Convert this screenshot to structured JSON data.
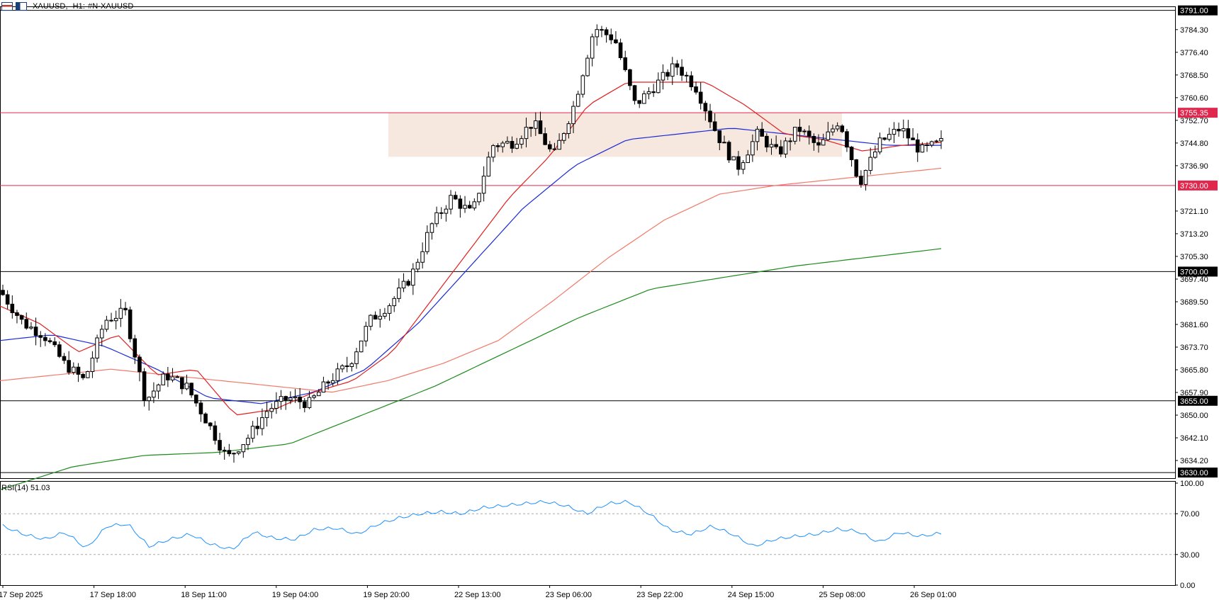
{
  "header": {
    "symbol": "XAUUSD",
    "timeframe": "H1:",
    "description": "#N-XAUUSD"
  },
  "price_axis": {
    "ticks": [
      "3784.30",
      "3776.40",
      "3768.50",
      "3760.60",
      "3752.70",
      "3744.80",
      "3736.90",
      "3721.10",
      "3713.20",
      "3705.30",
      "3697.40",
      "3689.50",
      "3681.60",
      "3673.70",
      "3665.80",
      "3657.90",
      "3650.00",
      "3642.10",
      "3634.20"
    ],
    "ylim": [
      3627.8,
      3792.4
    ]
  },
  "levels": [
    {
      "label": "3791.00",
      "value": 3791.0,
      "color": "#000000"
    },
    {
      "label": "3755.35",
      "value": 3755.35,
      "color": "#e0284f"
    },
    {
      "label": "3730.00",
      "value": 3730.0,
      "color": "#e0284f"
    },
    {
      "label": "3700.00",
      "value": 3700.0,
      "color": "#000000"
    },
    {
      "label": "3655.00",
      "value": 3655.0,
      "color": "#000000"
    },
    {
      "label": "3630.00",
      "value": 3630.0,
      "color": "#000000"
    }
  ],
  "zone": {
    "from_value": 3740.0,
    "to_value": 3755.35,
    "color": "#f7e8df"
  },
  "time_axis": [
    "17 Sep 2025",
    "17 Sep 18:00",
    "18 Sep 11:00",
    "19 Sep 04:00",
    "19 Sep 20:00",
    "22 Sep 13:00",
    "23 Sep 06:00",
    "23 Sep 22:00",
    "24 Sep 15:00",
    "25 Sep 08:00",
    "26 Sep 01:00"
  ],
  "rsi": {
    "label": "RSI(14) 51.03",
    "ticks": [
      "100.00",
      "70.00",
      "30.00",
      "0.00"
    ],
    "levels": [
      70,
      30
    ],
    "color": "#1e90ff"
  },
  "colors": {
    "ma_fast": "#e02020",
    "ma_mid": "#1a2bd6",
    "ma_slow": "#f07a6a",
    "ma_long": "#1c8a1c",
    "up_candle": "#ffffff",
    "down_candle": "#000000"
  },
  "chart_data": {
    "type": "candlestick",
    "interval": "H1",
    "x": [
      "17 Sep 2025",
      "17 Sep 18:00",
      "18 Sep 11:00",
      "19 Sep 04:00",
      "19 Sep 20:00",
      "22 Sep 13:00",
      "23 Sep 06:00",
      "23 Sep 22:00",
      "24 Sep 15:00",
      "25 Sep 08:00",
      "26 Sep 01:00"
    ],
    "close_path": [
      3692,
      3682,
      3678,
      3668,
      3662,
      3683,
      3686,
      3655,
      3664,
      3660,
      3648,
      3635,
      3642,
      3652,
      3656,
      3654,
      3662,
      3668,
      3683,
      3689,
      3698,
      3716,
      3726,
      3720,
      3744,
      3745,
      3752,
      3740,
      3758,
      3785,
      3781,
      3758,
      3765,
      3772,
      3764,
      3748,
      3736,
      3748,
      3741,
      3750,
      3743,
      3753,
      3731,
      3745,
      3750,
      3742,
      3745
    ],
    "ma_fast_path": [
      3688,
      3682,
      3672,
      3678,
      3664,
      3666,
      3650,
      3652,
      3658,
      3662,
      3672,
      3690,
      3708,
      3726,
      3740,
      3758,
      3766,
      3766,
      3766,
      3758,
      3748,
      3746,
      3742,
      3744,
      3745
    ],
    "ma_mid_path": [
      3676,
      3678,
      3674,
      3666,
      3656,
      3654,
      3658,
      3666,
      3682,
      3702,
      3722,
      3737,
      3746,
      3748,
      3750,
      3748,
      3746,
      3744,
      3744
    ],
    "ma_slow_path": [
      3662,
      3664,
      3666,
      3664,
      3662,
      3660,
      3658,
      3662,
      3668,
      3676,
      3690,
      3705,
      3718,
      3727,
      3730,
      3732,
      3734,
      3736
    ],
    "ma_long_path": [
      3624,
      3632,
      3636,
      3637,
      3640,
      3650,
      3660,
      3672,
      3684,
      3694,
      3698,
      3702,
      3705,
      3708
    ],
    "rsi_path": [
      58,
      50,
      45,
      52,
      36,
      58,
      60,
      38,
      45,
      50,
      40,
      35,
      52,
      46,
      45,
      55,
      56,
      50,
      60,
      66,
      70,
      72,
      70,
      76,
      78,
      80,
      82,
      78,
      70,
      80,
      82,
      70,
      54,
      50,
      58,
      50,
      38,
      45,
      48,
      50,
      55,
      53,
      42,
      52,
      48,
      51.03
    ]
  }
}
